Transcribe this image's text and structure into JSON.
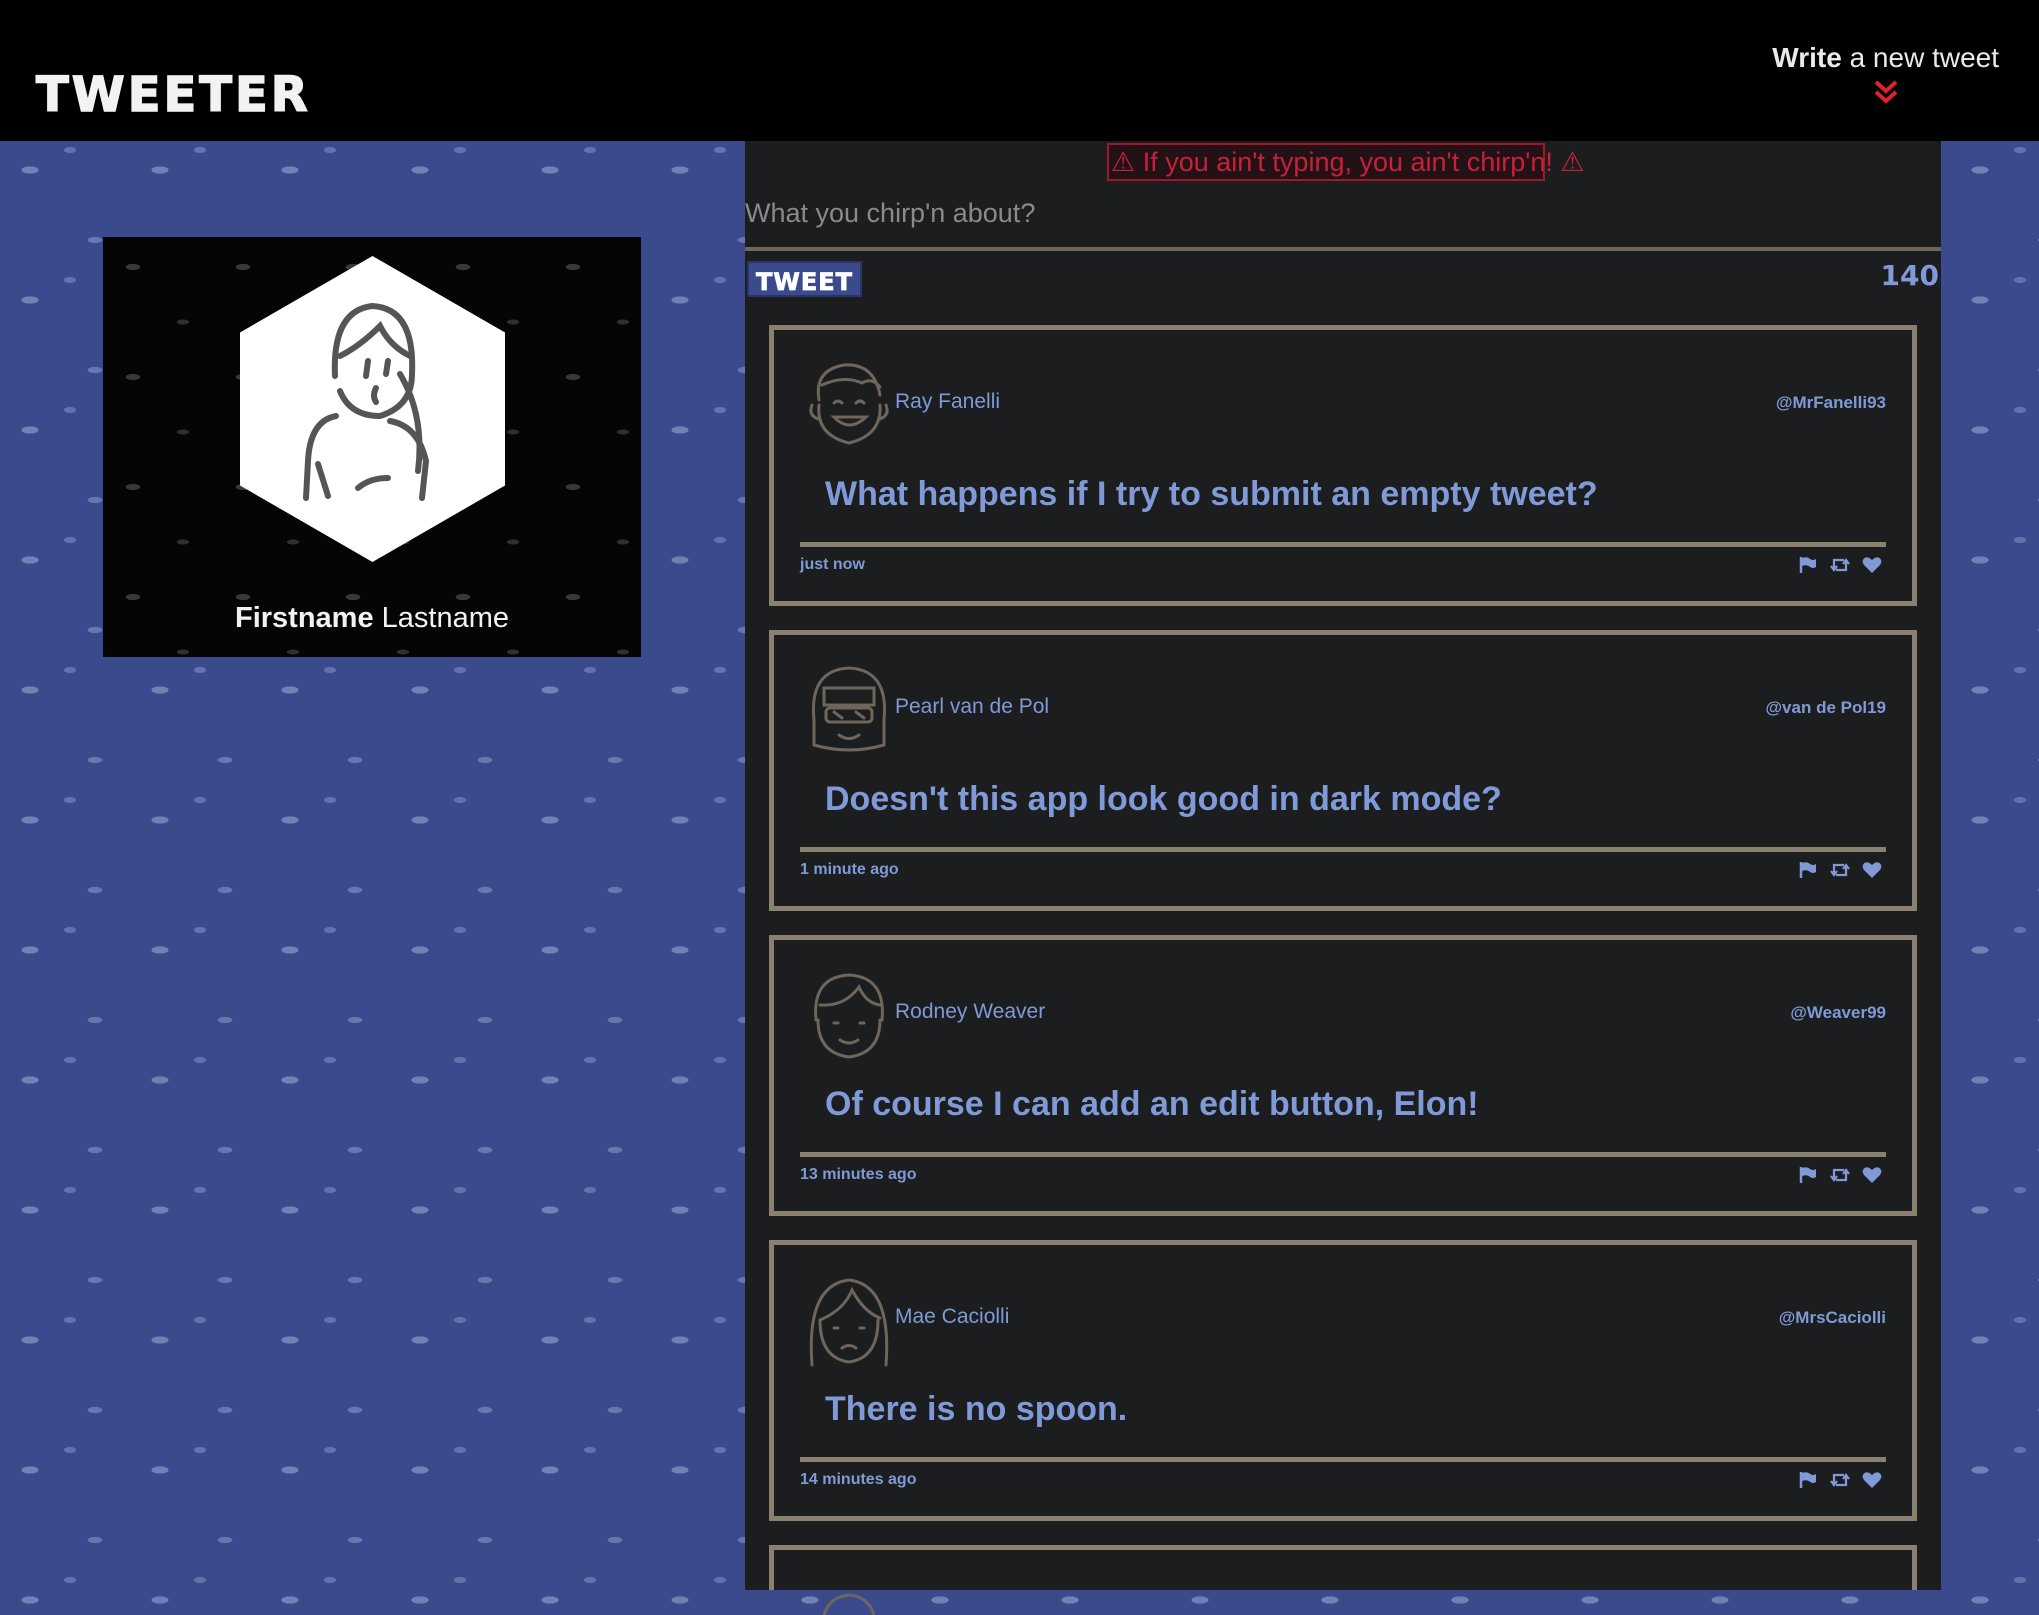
{
  "nav": {
    "brand": "TWEETER",
    "compose_bold": "Write",
    "compose_rest": " a new tweet",
    "compose_icon": "double-chevron-down-icon",
    "accent": "#e0202a"
  },
  "profile": {
    "first_name": "Firstname",
    "last_name": " Lastname"
  },
  "composer": {
    "error": "⚠ If you ain't typing, you ain't chirp'n! ⚠",
    "placeholder": "What you chirp'n about?",
    "submit_label": "TWEET",
    "counter": "140"
  },
  "tweets": [
    {
      "author": "Ray Fanelli",
      "handle": "@MrFanelli93",
      "text": "What happens if I try to submit an empty tweet?",
      "time": "just now"
    },
    {
      "author": "Pearl van de Pol",
      "handle": "@van de Pol19",
      "text": "Doesn't this app look good in dark mode?",
      "time": "1 minute ago"
    },
    {
      "author": "Rodney Weaver",
      "handle": "@Weaver99",
      "text": "Of course I can add an edit button, Elon!",
      "time": "13 minutes ago"
    },
    {
      "author": "Mae Caciolli",
      "handle": "@MrsCaciolli",
      "text": "There is no spoon.",
      "time": "14 minutes ago"
    }
  ],
  "colors": {
    "background": "#3a4a8c",
    "panel": "#1c1d1f",
    "border": "#8a8070",
    "text_accent": "#7f9ad6",
    "error": "#c8203a"
  },
  "icons": [
    "flag-icon",
    "retweet-icon",
    "heart-icon"
  ]
}
